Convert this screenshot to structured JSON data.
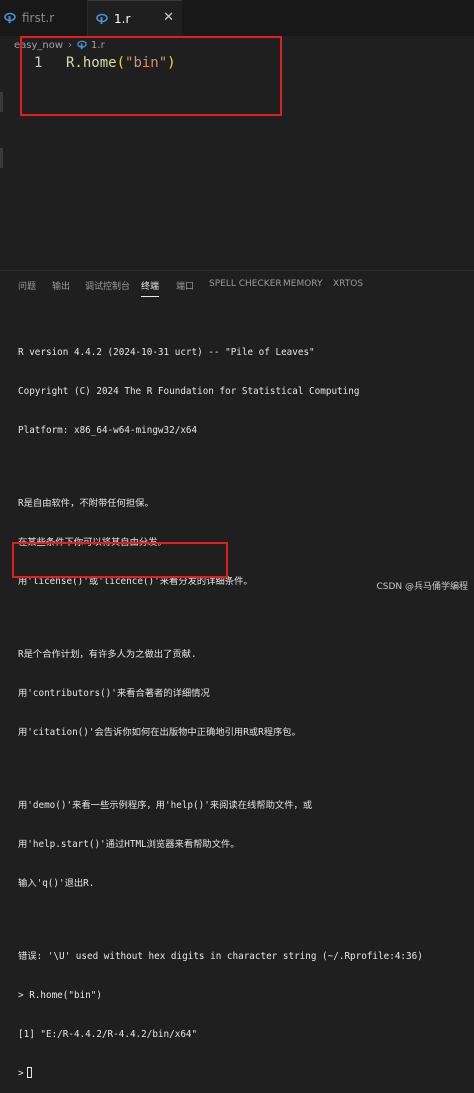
{
  "tabs": [
    {
      "label": "first.r",
      "active": false
    },
    {
      "label": "1.r",
      "active": true
    }
  ],
  "close_glyph": "✕",
  "breadcrumb": [
    "easy_now",
    "1.r"
  ],
  "editor": {
    "line_number": "1",
    "code": {
      "fn": "R.home",
      "open": "(",
      "str": "\"bin\"",
      "close": ")"
    }
  },
  "panel_tabs": [
    "问题",
    "输出",
    "调试控制台",
    "终端",
    "端口",
    "SPELL CHECKER",
    "MEMORY",
    "XRTOS"
  ],
  "active_panel_tab": "终端",
  "terminal_lines": [
    "R version 4.4.2 (2024-10-31 ucrt) -- \"Pile of Leaves\"",
    "Copyright (C) 2024 The R Foundation for Statistical Computing",
    "Platform: x86_64-w64-mingw32/x64",
    "",
    "R是自由软件，不附带任何担保。",
    "在某些条件下你可以将其自由分发。",
    "用'license()'或'licence()'来看分发的详细条件。",
    "",
    "R是个合作计划，有许多人为之做出了贡献.",
    "用'contributors()'来看合著者的详细情况",
    "用'citation()'会告诉你如何在出版物中正确地引用R或R程序包。",
    "",
    "用'demo()'来看一些示例程序，用'help()'来阅读在线帮助文件，或",
    "用'help.start()'通过HTML浏览器来看帮助文件。",
    "输入'q()'退出R.",
    "",
    "错误: '\\U' used without hex digits in character string (~/.Rprofile:4:36)",
    "> R.home(\"bin\")",
    "[1] \"E:/R-4.4.2/R-4.4.2/bin/x64\"",
    ">"
  ],
  "watermark": "CSDN @兵马俑学编程",
  "colors": {
    "accent_red": "#e0201c",
    "r_icon": "#4a8fd6"
  }
}
